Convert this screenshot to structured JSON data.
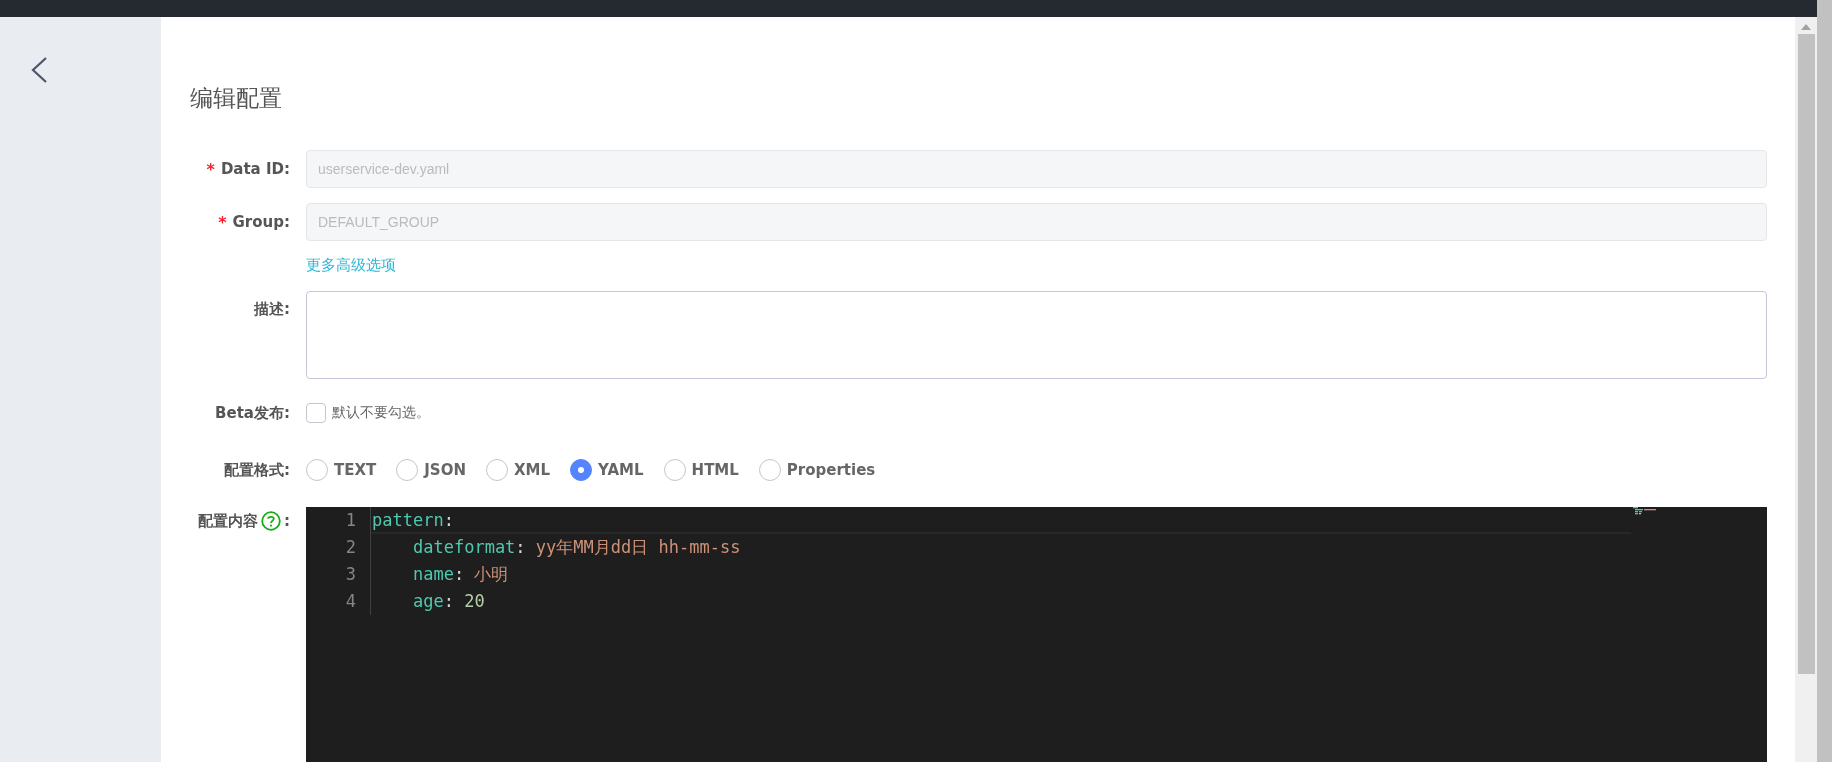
{
  "page": {
    "title": "编辑配置"
  },
  "form": {
    "data_id": {
      "label": "Data ID:",
      "required_mark": "*",
      "value": "userservice-dev.yaml"
    },
    "group": {
      "label": "Group:",
      "required_mark": "*",
      "value": "DEFAULT_GROUP"
    },
    "advanced_link": "更多高级选项",
    "description": {
      "label": "描述:"
    },
    "beta": {
      "label": "Beta发布:",
      "checked": false,
      "hint": "默认不要勾选。"
    },
    "format": {
      "label": "配置格式:",
      "options": [
        {
          "label": "TEXT",
          "selected": false
        },
        {
          "label": "JSON",
          "selected": false
        },
        {
          "label": "XML",
          "selected": false
        },
        {
          "label": "YAML",
          "selected": true
        },
        {
          "label": "HTML",
          "selected": false
        },
        {
          "label": "Properties",
          "selected": false
        }
      ]
    },
    "content": {
      "label": "配置内容",
      "colon": ":"
    }
  },
  "editor": {
    "lines": [
      {
        "number": "1",
        "tokens": [
          {
            "text": "pattern",
            "kind": "key"
          },
          {
            "text": ":",
            "kind": "punct"
          }
        ],
        "children": [
          {
            "number": "2",
            "tokens": [
              {
                "text": "dateformat",
                "kind": "key"
              },
              {
                "text": ": ",
                "kind": "punct"
              },
              {
                "text": "yy年MM月dd日 hh-mm-ss",
                "kind": "string"
              }
            ]
          },
          {
            "number": "3",
            "tokens": [
              {
                "text": "name",
                "kind": "key"
              },
              {
                "text": ": ",
                "kind": "punct"
              },
              {
                "text": "小明",
                "kind": "string"
              }
            ]
          },
          {
            "number": "4",
            "tokens": [
              {
                "text": "age",
                "kind": "key"
              },
              {
                "text": ": ",
                "kind": "punct"
              },
              {
                "text": "20",
                "kind": "number"
              }
            ]
          }
        ]
      }
    ]
  }
}
